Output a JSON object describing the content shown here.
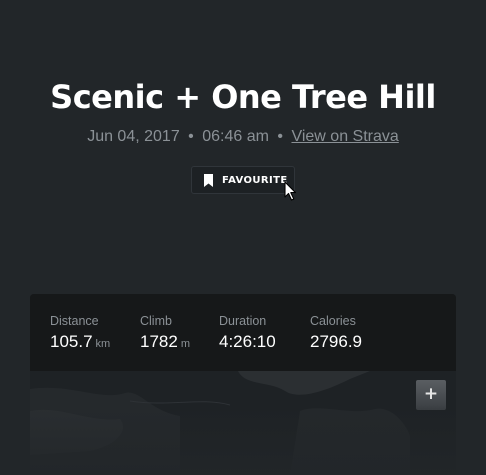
{
  "activity": {
    "title": "Scenic + One Tree Hill",
    "date": "Jun 04, 2017",
    "separator": "•",
    "time": "06:46 am",
    "strava_link": "View on Strava"
  },
  "favourite": {
    "label": "FAVOURITE",
    "icon": "bookmark-icon"
  },
  "stats": [
    {
      "label": "Distance",
      "value": "105.7",
      "unit": "km"
    },
    {
      "label": "Climb",
      "value": "1782",
      "unit": "m"
    },
    {
      "label": "Duration",
      "value": "4:26:10",
      "unit": ""
    },
    {
      "label": "Calories",
      "value": "2796.9",
      "unit": ""
    }
  ],
  "map": {
    "zoom_in_label": "+"
  },
  "colors": {
    "background": "#222629",
    "stats_bar": "#161819",
    "muted_text": "#8b9196"
  }
}
